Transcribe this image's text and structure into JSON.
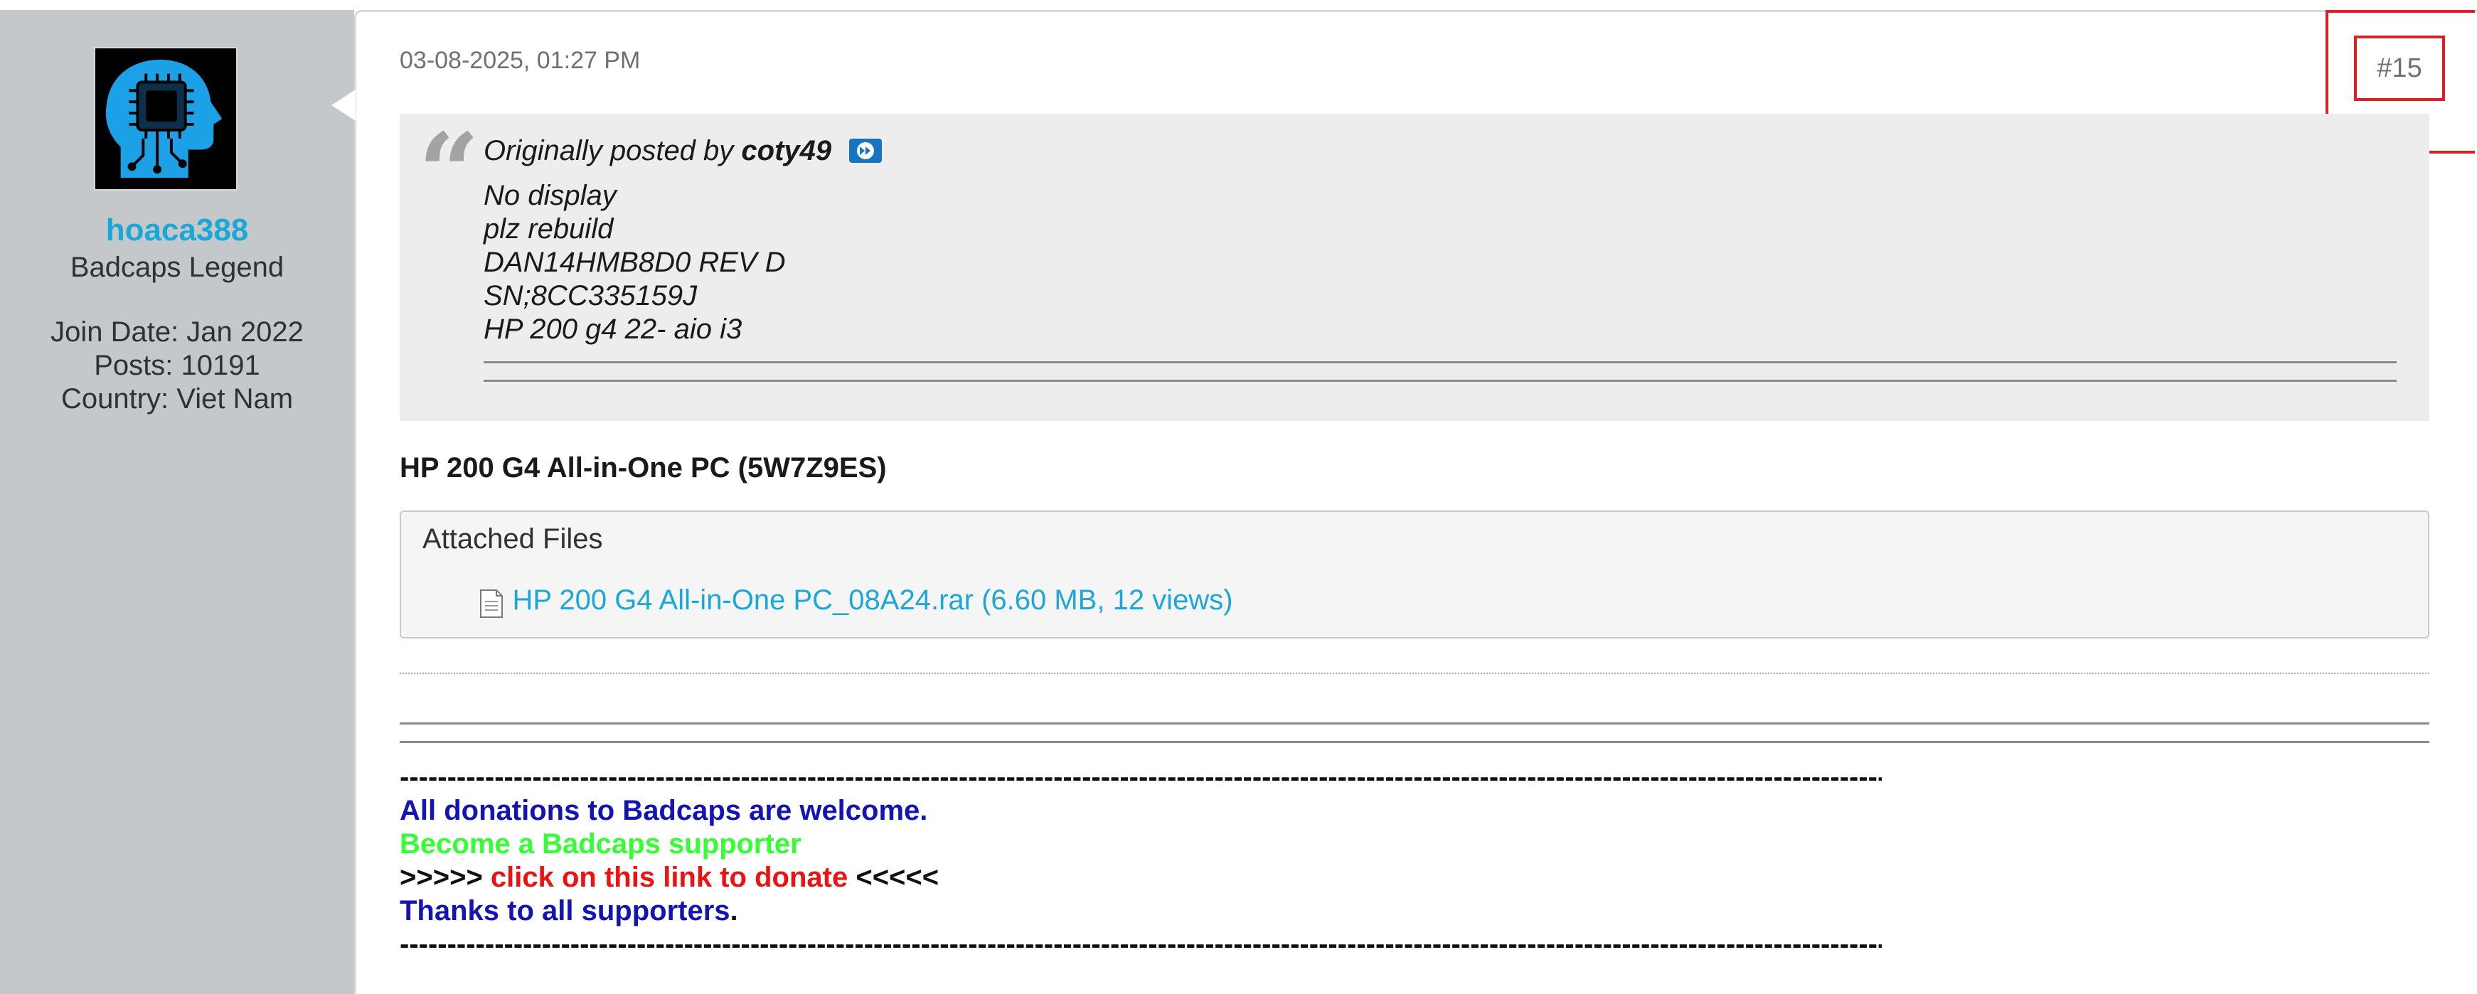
{
  "user": {
    "username": "hoaca388",
    "title": "Badcaps Legend",
    "join_date": "Join Date: Jan 2022",
    "posts": "Posts: 10191",
    "country": "Country: Viet Nam",
    "avatar_icon": "ai-chip-head-icon"
  },
  "post": {
    "date": "03-08-2025, 01:27 PM",
    "number": "#15",
    "quote": {
      "prefix": "Originally posted by",
      "author": "coty49",
      "link_icon": "view-post-icon",
      "lines": [
        "No display",
        "plz rebuild",
        "DAN14HMB8D0 REV D",
        "SN;8CC335159J",
        "HP 200 g4 22- aio i3"
      ]
    },
    "text": "HP 200 G4 All-in-One PC (5W7Z9ES)",
    "attachments": {
      "title": "Attached Files",
      "files": [
        {
          "icon": "document-icon",
          "label": "HP 200 G4 All-in-One PC_08A24.rar (6.60 MB, 12 views)"
        }
      ]
    }
  },
  "signature": {
    "dashes": "-----------------------------------------------------------------------------------------------------------------------------------------------------------------",
    "line1": "All donations to Badcaps are welcome.",
    "line2": "Become a Badcaps supporter",
    "line3_prefix": ">>>>> ",
    "line3_link": "click on this link to donate",
    "line3_suffix": " <<<<<",
    "line4": "Thanks to all supporters",
    "line4_end": ".",
    "colors": {
      "blue": "#1414b4",
      "green": "#33ff33",
      "red": "#ee1111"
    }
  },
  "colors": {
    "sidebar_bg": "#c5c8cb",
    "username": "#1ba7d8",
    "link": "#1ba7d8",
    "highlight_box": "#d92128",
    "quote_bg": "#ededed"
  }
}
